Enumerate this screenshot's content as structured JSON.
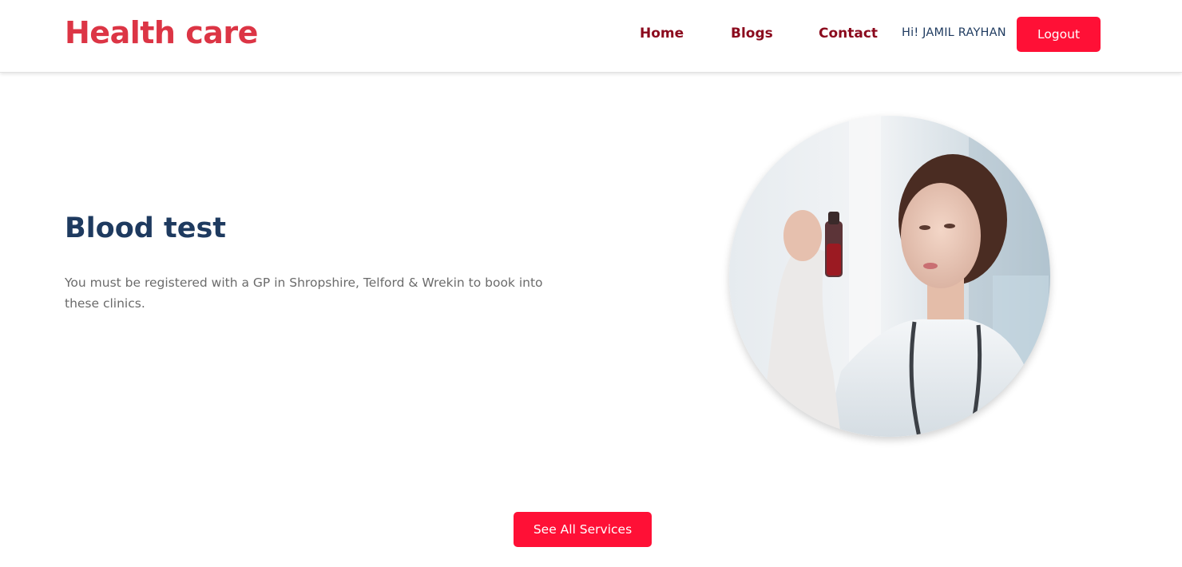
{
  "header": {
    "logo": "Health care",
    "nav": [
      {
        "label": "Home"
      },
      {
        "label": "Blogs"
      },
      {
        "label": "Contact"
      }
    ],
    "greeting": "Hi! JAMIL RAYHAN",
    "logout_label": "Logout"
  },
  "hero": {
    "title": "Blood test",
    "description": "You must be registered with a GP in Shropshire, Telford & Wrekin to book into these clinics.",
    "image_alt": "Doctor holding a blood sample vial"
  },
  "actions": {
    "see_all_label": "See All Services"
  },
  "colors": {
    "brand_red": "#dc3545",
    "button_red": "#ff1036",
    "nav_text": "#8b0a1d",
    "title_navy": "#1e3a5f",
    "body_gray": "#6b6b6b"
  }
}
